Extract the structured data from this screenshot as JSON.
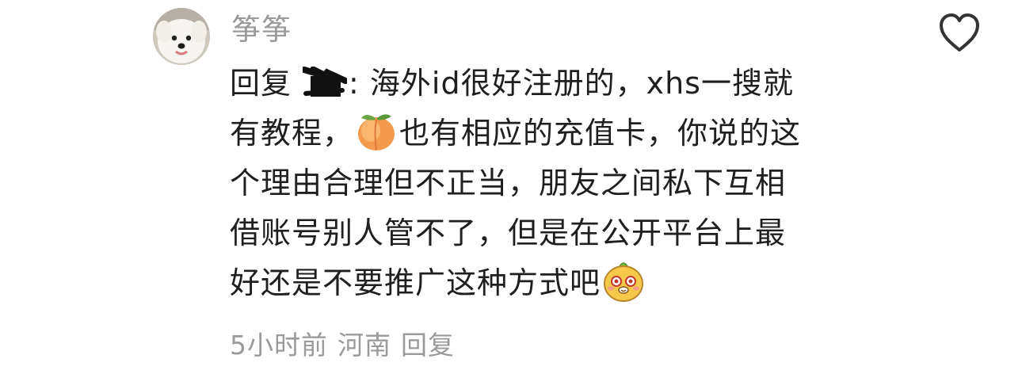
{
  "comment": {
    "username": "筝筝",
    "reply_prefix": "回复",
    "lines": [
      "海外id很好注册的，xhs一搜就",
      "有教程，",
      "也有相应的充值卡，你说的这",
      "个理由合理但不正当，朋友之间私下互相",
      "借账号别人管不了，但是在公开平台上最",
      "好还是不要推广这种方式吧"
    ],
    "reply_separator": ":",
    "timestamp": "5小时前",
    "location": "河南",
    "reply_action": "回复",
    "icons": {
      "like": "heart-outline-icon",
      "emoji_1": "peach-emoji",
      "emoji_2": "cute-mascot-emoji"
    },
    "colors": {
      "text": "#1f1f1f",
      "meta": "#9a9a9a",
      "icon": "#333333"
    }
  }
}
